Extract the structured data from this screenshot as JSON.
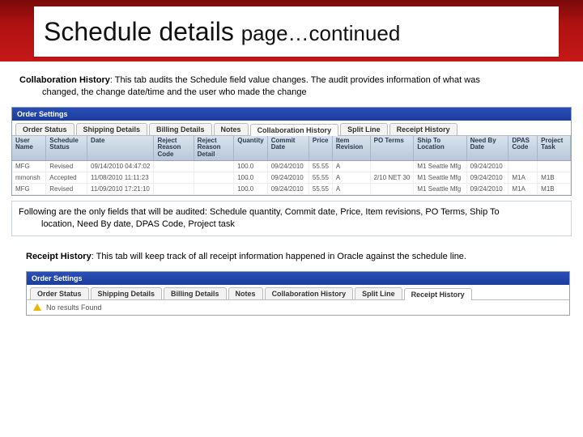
{
  "title_main": "Schedule details ",
  "title_sub": "page…continued",
  "collab_label": "Collaboration History",
  "collab_text_1": ":  This tab  audits the Schedule field value changes. The audit provides information of what was",
  "collab_text_2": "changed, the change date/time and the user who made the change",
  "app_title": "Order Settings",
  "tabs": {
    "t0": "Order Status",
    "t1": "Shipping Details",
    "t2": "Billing Details",
    "t3": "Notes",
    "t4": "Collaboration History",
    "t5": "Split Line",
    "t6": "Receipt History"
  },
  "cols": {
    "c0": "User Name",
    "c1": "Schedule Status",
    "c2": "Date",
    "c3": "Reject Reason Code",
    "c4": "Reject Reason Detail",
    "c5": "Quantity",
    "c6": "Commit Date",
    "c7": "Price",
    "c8": "Item Revision",
    "c9": "PO Terms",
    "c10": "Ship To Location",
    "c11": "Need By Date",
    "c12": "DPAS Code",
    "c13": "Project Task"
  },
  "rows": [
    {
      "c0": "MFG",
      "c1": "Revised",
      "c2": "09/14/2010 04:47:02",
      "c3": "",
      "c4": "",
      "c5": "100.0",
      "c6": "09/24/2010",
      "c7": "55.55",
      "c8": "A",
      "c9": "",
      "c10": "M1 Seattle Mfg",
      "c11": "09/24/2010",
      "c12": "",
      "c13": ""
    },
    {
      "c0": "mmonsh",
      "c1": "Accepted",
      "c2": "11/08/2010 11:11:23",
      "c3": "",
      "c4": "",
      "c5": "100.0",
      "c6": "09/24/2010",
      "c7": "55.55",
      "c8": "A",
      "c9": "2/10 NET 30",
      "c10": "M1 Seattle Mfg",
      "c11": "09/24/2010",
      "c12": "M1A",
      "c13": "M1B"
    },
    {
      "c0": "MFG",
      "c1": "Revised",
      "c2": "11/09/2010 17:21:10",
      "c3": "",
      "c4": "",
      "c5": "100.0",
      "c6": "09/24/2010",
      "c7": "55.55",
      "c8": "A",
      "c9": "",
      "c10": "M1 Seattle Mfg",
      "c11": "09/24/2010",
      "c12": "M1A",
      "c13": "M1B"
    }
  ],
  "note_line1": "Following are the only fields that will be audited: Schedule quantity, Commit date, Price, Item revisions, PO Terms, Ship To",
  "note_line2": "location, Need By date, DPAS Code, Project task",
  "receipt_label": "Receipt History",
  "receipt_text": ":  This tab  will keep track of all receipt information happened in Oracle against the schedule line.",
  "no_results": "No results Found"
}
